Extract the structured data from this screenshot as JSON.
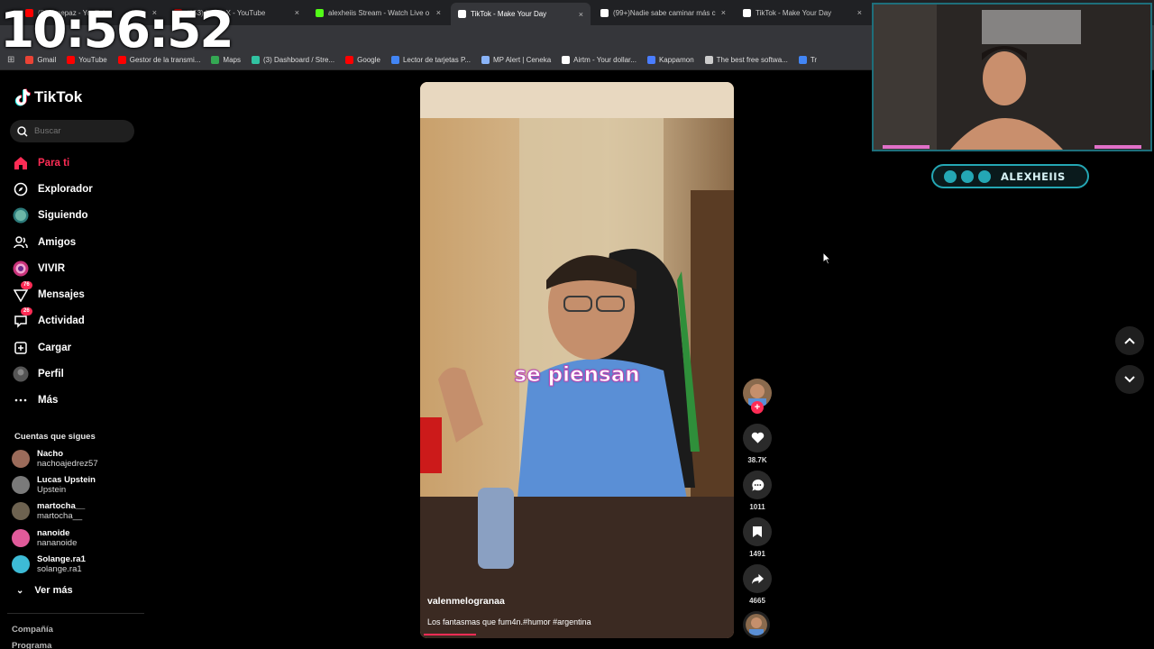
{
  "clock": "10:56:52",
  "browser": {
    "tabs": [
      {
        "title": "(853) pepaz - YouTube",
        "favicon": "youtube-icon",
        "active": false
      },
      {
        "title": "(853) PepazX - YouTube",
        "favicon": "youtube-icon",
        "active": false
      },
      {
        "title": "alexheiis Stream - Watch Live o",
        "favicon": "kick-icon",
        "active": false
      },
      {
        "title": "TikTok - Make Your Day",
        "favicon": "tiktok-icon",
        "active": true
      },
      {
        "title": "(99+)Nadie sabe caminar más c",
        "favicon": "tiktok-icon",
        "active": false
      },
      {
        "title": "TikTok - Make Your Day",
        "favicon": "tiktok-icon",
        "active": false
      }
    ],
    "bookmarks": [
      {
        "label": "Gmail",
        "icon": "gmail-icon",
        "color": "#ea4335"
      },
      {
        "label": "YouTube",
        "icon": "youtube-icon",
        "color": "#ff0000"
      },
      {
        "label": "Gestor de la transmi...",
        "icon": "youtube-icon",
        "color": "#ff0000"
      },
      {
        "label": "Maps",
        "icon": "maps-icon",
        "color": "#34a853"
      },
      {
        "label": "(3) Dashboard / Stre...",
        "icon": "streamlabs-icon",
        "color": "#31c3a2"
      },
      {
        "label": "Google",
        "icon": "youtube-icon",
        "color": "#ff0000"
      },
      {
        "label": "Lector de tarjetas P...",
        "icon": "google-icon",
        "color": "#4285f4"
      },
      {
        "label": "MP Alert | Ceneka",
        "icon": "card-icon",
        "color": "#8ab4f8"
      },
      {
        "label": "Airtm - Your dollar...",
        "icon": "mp-icon",
        "color": "#ffffff"
      },
      {
        "label": "Kappamon",
        "icon": "airtm-icon",
        "color": "#4a7dff"
      },
      {
        "label": "The best free softwa...",
        "icon": "kappamon-icon",
        "color": "#cccccc"
      },
      {
        "label": "Tr",
        "icon": "translate-icon",
        "color": "#4285f4"
      }
    ]
  },
  "sidebar": {
    "logo_text": "TikTok",
    "search_placeholder": "Buscar",
    "nav": [
      {
        "label": "Para ti",
        "icon": "home-icon"
      },
      {
        "label": "Explorador",
        "icon": "compass-icon"
      },
      {
        "label": "Siguiendo",
        "icon": "following-icon"
      },
      {
        "label": "Amigos",
        "icon": "friends-icon"
      },
      {
        "label": "VIVIR",
        "icon": "live-icon"
      },
      {
        "label": "Mensajes",
        "icon": "messages-icon",
        "badge": "76"
      },
      {
        "label": "Actividad",
        "icon": "activity-icon",
        "badge": "26"
      },
      {
        "label": "Cargar",
        "icon": "upload-icon"
      },
      {
        "label": "Perfil",
        "icon": "profile-icon"
      },
      {
        "label": "Más",
        "icon": "more-icon"
      }
    ],
    "following_title": "Cuentas que sigues",
    "accounts": [
      {
        "name": "Nacho",
        "username": "nachoajedrez57",
        "color": "#9b6b5a"
      },
      {
        "name": "Lucas Upstein",
        "username": "Upstein",
        "color": "#7a7a7a"
      },
      {
        "name": "martocha__",
        "username": "martocha__",
        "color": "#6d6250"
      },
      {
        "name": "nanoide",
        "username": "nananoide",
        "color": "#e05a9a"
      },
      {
        "name": "Solange.ra1",
        "username": "solange.ra1",
        "color": "#3dbbd6"
      }
    ],
    "see_more": "Ver más",
    "footer_links": [
      "Compañía",
      "Programa"
    ]
  },
  "video": {
    "overlay_text": "se piensan",
    "username": "valenmelogranaa",
    "description": "Los fantasmas que fum4n.#humor #argentina",
    "progress": 0.17
  },
  "actions": {
    "likes": "38.7K",
    "comments": "1011",
    "saves": "1491",
    "shares": "4665"
  },
  "overlay": {
    "social_handle": "ALEXHEIIS"
  }
}
